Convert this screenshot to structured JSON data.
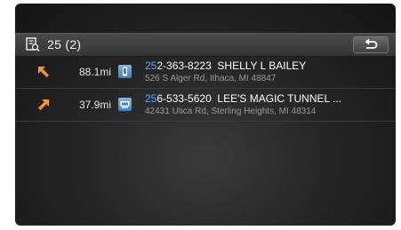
{
  "header": {
    "title": "25 (2)",
    "search_icon": "phonebook-search-icon",
    "back_icon": "return-arrow-icon"
  },
  "colors": {
    "match_highlight": "#5aa6ff",
    "direction_arrow": "#f39a1e",
    "type_icon": "#4a90d9"
  },
  "results": [
    {
      "direction_icon": "arrow-up-left-icon",
      "distance": "88.1mi",
      "type_icon": "mobile-phone-icon",
      "phone_match": "25",
      "phone_rest": "2-363-8223",
      "name": "SHELLY L BAILEY",
      "address": "526 S Alger Rd, Ithaca, MI 48847"
    },
    {
      "direction_icon": "arrow-up-right-icon",
      "distance": "37.9mi",
      "type_icon": "business-phone-icon",
      "phone_match": "25",
      "phone_rest": "6-533-5620",
      "name": "LEE'S MAGIC TUNNEL ...",
      "address": "42431 Utica Rd, Sterling Heights, MI 48314"
    }
  ]
}
